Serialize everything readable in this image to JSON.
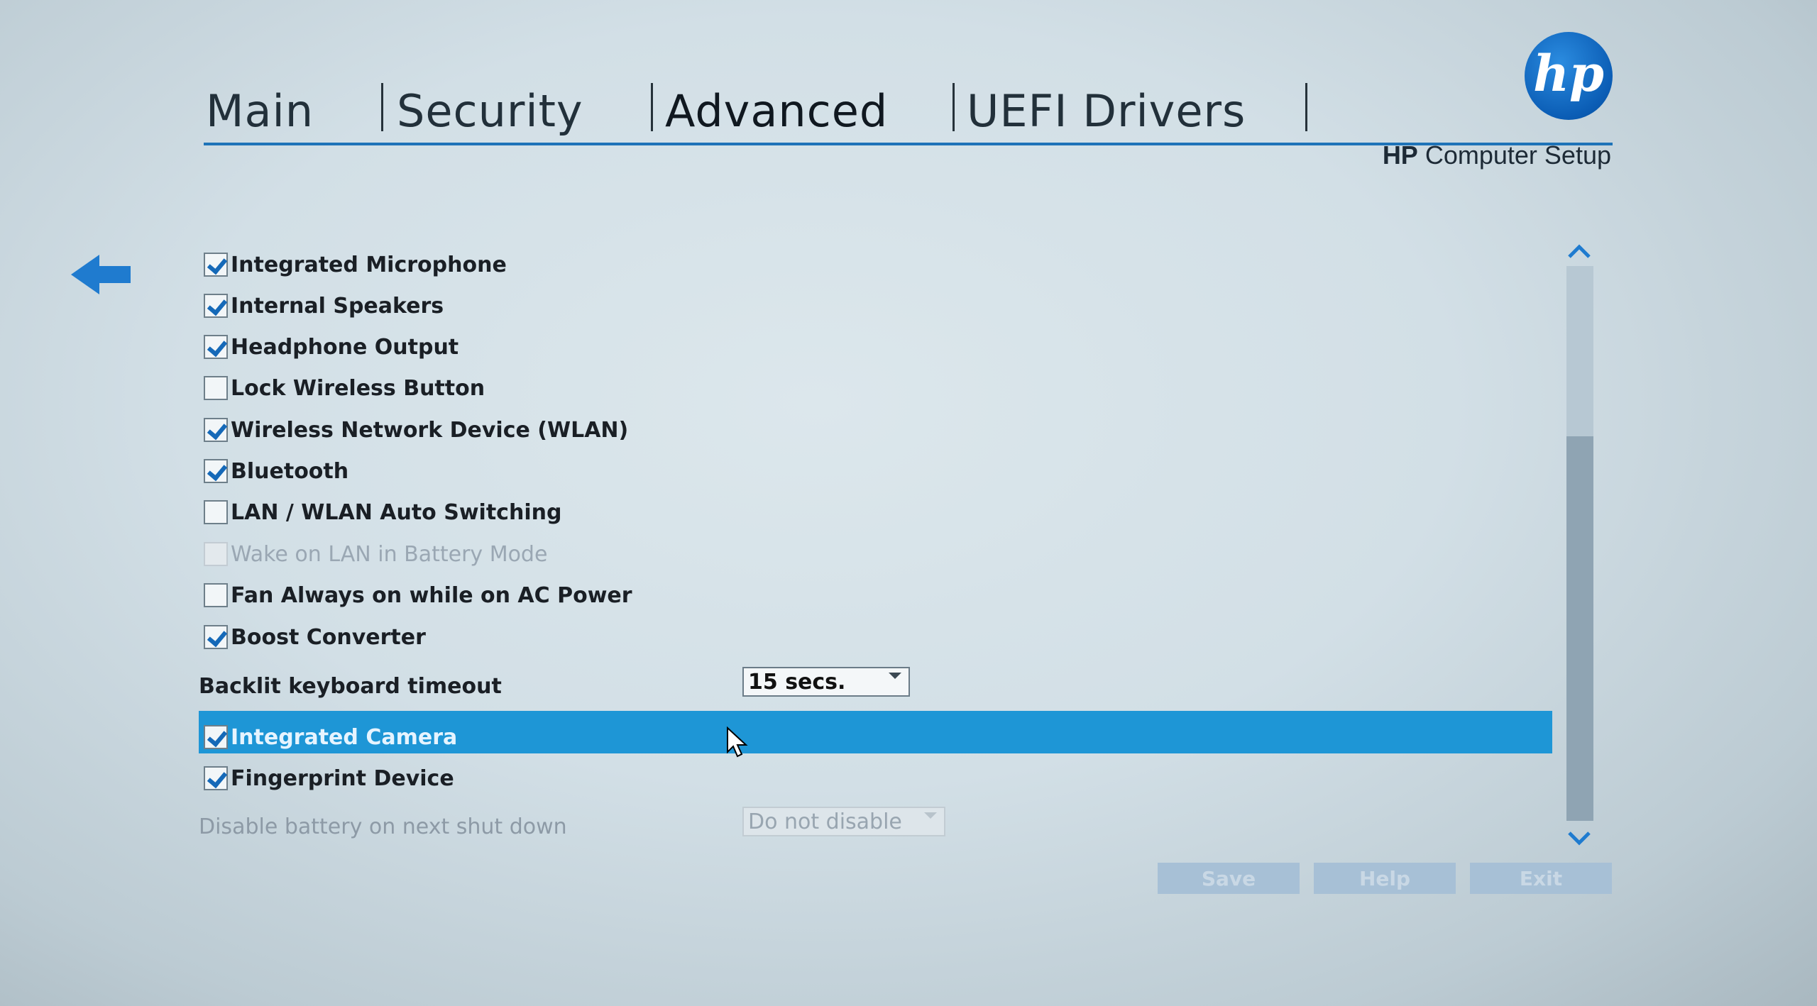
{
  "tabs": [
    "Main",
    "Security",
    "Advanced",
    "UEFI Drivers"
  ],
  "active_tab": "Advanced",
  "logo": {
    "text": "hp",
    "color": "#0b5db5"
  },
  "product": {
    "brand": "HP",
    "name": "Computer Setup"
  },
  "back_icon": "left-arrow-icon",
  "options": [
    {
      "label": "Integrated Microphone",
      "checked": true,
      "enabled": true
    },
    {
      "label": "Internal Speakers",
      "checked": true,
      "enabled": true
    },
    {
      "label": "Headphone Output",
      "checked": true,
      "enabled": true
    },
    {
      "label": "Lock Wireless Button",
      "checked": false,
      "enabled": true
    },
    {
      "label": "Wireless Network Device (WLAN)",
      "checked": true,
      "enabled": true
    },
    {
      "label": "Bluetooth",
      "checked": true,
      "enabled": true
    },
    {
      "label": "LAN / WLAN Auto Switching",
      "checked": false,
      "enabled": true
    },
    {
      "label": "Wake on LAN in Battery Mode",
      "checked": false,
      "enabled": false
    },
    {
      "label": "Fan Always on while on AC Power",
      "checked": false,
      "enabled": true
    },
    {
      "label": "Boost Converter",
      "checked": true,
      "enabled": true
    }
  ],
  "backlit": {
    "label": "Backlit keyboard timeout",
    "value": "15 secs."
  },
  "options2": [
    {
      "label": "Integrated Camera",
      "checked": true,
      "enabled": true,
      "selected": true
    },
    {
      "label": "Fingerprint Device",
      "checked": true,
      "enabled": true
    }
  ],
  "battery": {
    "label": "Disable battery on next shut down",
    "value": "Do not disable",
    "enabled": false
  },
  "buttons": {
    "save": "Save",
    "help": "Help",
    "exit": "Exit"
  },
  "colors": {
    "accent": "#1e73b8",
    "selection": "#1e96d6"
  }
}
